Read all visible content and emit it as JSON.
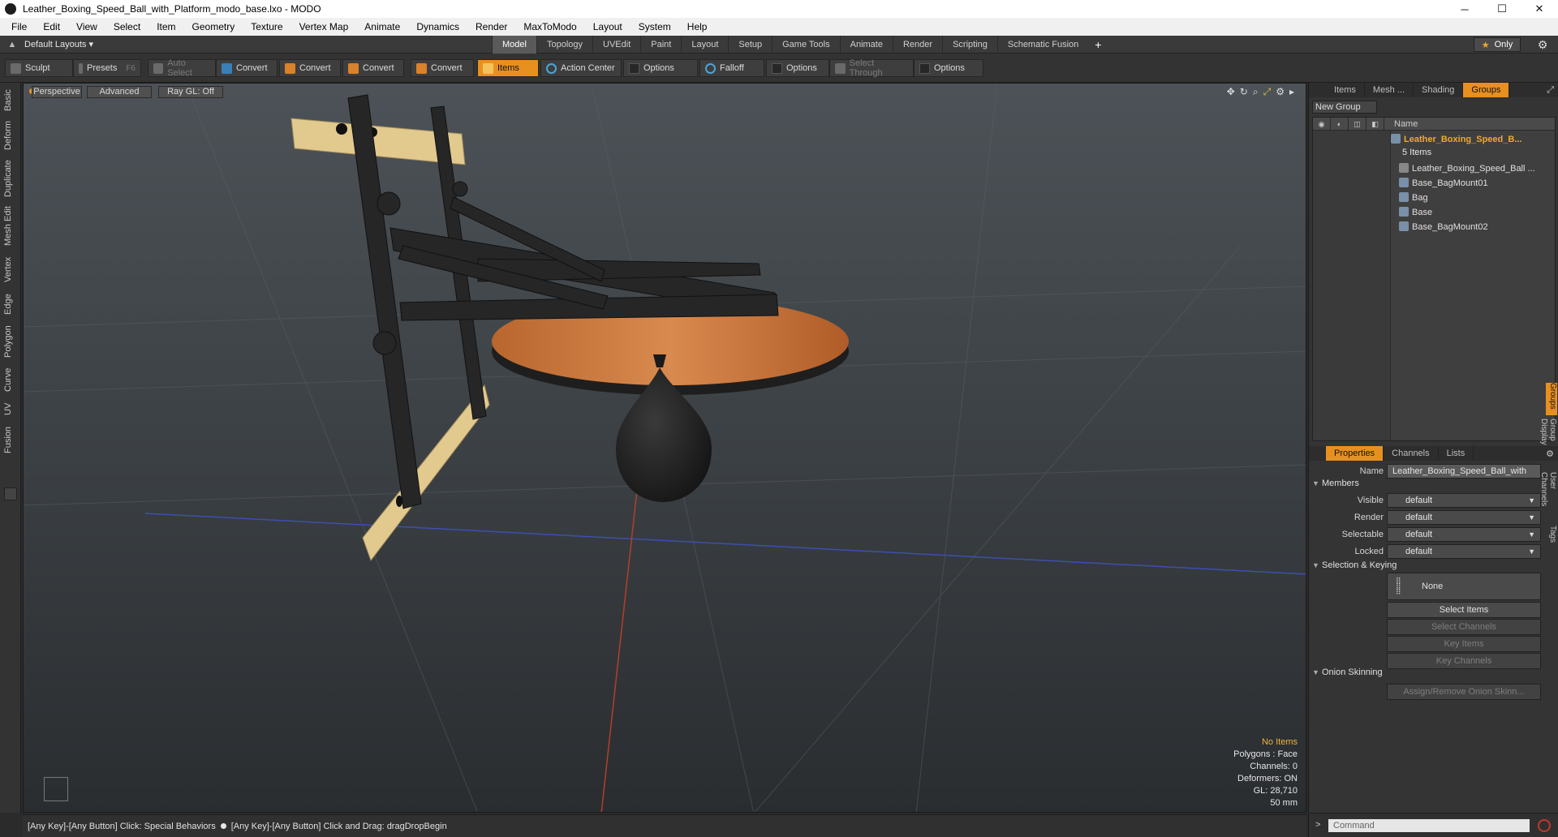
{
  "window": {
    "title": "Leather_Boxing_Speed_Ball_with_Platform_modo_base.lxo - MODO",
    "min": "─",
    "max": "☐",
    "close": "✕"
  },
  "menubar": [
    "File",
    "Edit",
    "View",
    "Select",
    "Item",
    "Geometry",
    "Texture",
    "Vertex Map",
    "Animate",
    "Dynamics",
    "Render",
    "MaxToModo",
    "Layout",
    "System",
    "Help"
  ],
  "layoutbar": {
    "layouts_label": "Default Layouts ▾",
    "tabs": [
      "Model",
      "Topology",
      "UVEdit",
      "Paint",
      "Layout",
      "Setup",
      "Game Tools",
      "Animate",
      "Render",
      "Scripting",
      "Schematic Fusion"
    ],
    "active_tab": "Model",
    "plus": "+",
    "only_label": "Only",
    "only_star": "★"
  },
  "toolbar": {
    "sculpt": "Sculpt",
    "presets": "Presets",
    "presets_key": "F6",
    "auto_select": "Auto Select",
    "convert1": "Convert",
    "convert2": "Convert",
    "convert3": "Convert",
    "convert4": "Convert",
    "items": "Items",
    "action_center": "Action Center",
    "options1": "Options",
    "falloff": "Falloff",
    "options2": "Options",
    "select_through": "Select Through",
    "options3": "Options"
  },
  "left_tabs": [
    "Basic",
    "Deform",
    "Duplicate",
    "Mesh Edit",
    "Vertex",
    "Edge",
    "Polygon",
    "Curve",
    "UV",
    "Fusion"
  ],
  "viewport": {
    "perspective": "Perspective",
    "advanced": "Advanced",
    "raygl": "Ray GL: Off",
    "stats": {
      "no_items": "No Items",
      "polygons": "Polygons : Face",
      "channels": "Channels: 0",
      "deformers": "Deformers: ON",
      "gl": "GL: 28,710",
      "size": "50 mm"
    }
  },
  "statusbar": {
    "text1": "[Any Key]-[Any Button] Click: Special Behaviors",
    "text2": "[Any Key]-[Any Button] Click and Drag: dragDropBegin"
  },
  "right_panel": {
    "top_tabs": [
      "Items",
      "Mesh ...",
      "Shading",
      "Groups"
    ],
    "top_active": "Groups",
    "new_group": "New Group",
    "name_header": "Name",
    "group_name": "Leather_Boxing_Speed_B...",
    "group_count": "5 Items",
    "children": [
      "Leather_Boxing_Speed_Ball ...",
      "Base_BagMount01",
      "Bag",
      "Base",
      "Base_BagMount02"
    ],
    "prop_tabs": [
      "Properties",
      "Channels",
      "Lists"
    ],
    "prop_active": "Properties",
    "name_label": "Name",
    "name_value": "Leather_Boxing_Speed_Ball_with",
    "members": "Members",
    "visible_label": "Visible",
    "visible_value": "default",
    "render_label": "Render",
    "render_value": "default",
    "selectable_label": "Selectable",
    "selectable_value": "default",
    "locked_label": "Locked",
    "locked_value": "default",
    "selection_keying": "Selection & Keying",
    "none": "None",
    "select_items": "Select Items",
    "select_channels": "Select Channels",
    "key_items": "Key Items",
    "key_channels": "Key Channels",
    "onion_skinning": "Onion Skinning",
    "assign_remove": "Assign/Remove Onion Skinn...",
    "side_tabs": [
      "Groups",
      "Group Display",
      "User Channels",
      "Tags"
    ],
    "command_placeholder": "Command"
  }
}
